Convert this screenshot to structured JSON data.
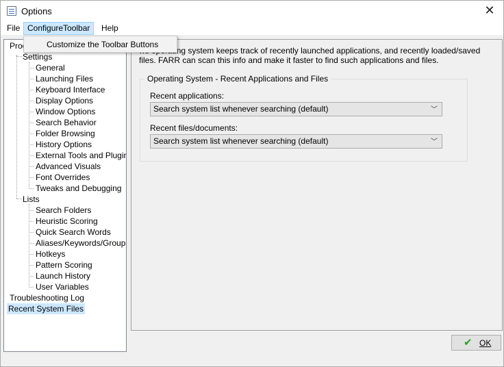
{
  "window": {
    "title": "Options",
    "close_glyph": "✕"
  },
  "menubar": {
    "items": [
      {
        "label": "File"
      },
      {
        "label": "ConfigureToolbar"
      },
      {
        "label": "Help"
      }
    ],
    "active_menu": "ConfigureToolbar",
    "dropdown_items": [
      {
        "label": "Customize the Toolbar Buttons"
      }
    ]
  },
  "tree": {
    "items": [
      {
        "label": "Prog"
      },
      {
        "label": "Settings"
      },
      {
        "label": "General"
      },
      {
        "label": "Launching Files"
      },
      {
        "label": "Keyboard Interface"
      },
      {
        "label": "Display Options"
      },
      {
        "label": "Window Options"
      },
      {
        "label": "Search Behavior"
      },
      {
        "label": "Folder Browsing"
      },
      {
        "label": "History Options"
      },
      {
        "label": "External Tools and Plugins"
      },
      {
        "label": "Advanced Visuals"
      },
      {
        "label": "Font Overrides"
      },
      {
        "label": "Tweaks and Debugging"
      },
      {
        "label": "Lists"
      },
      {
        "label": "Search Folders"
      },
      {
        "label": "Heuristic Scoring"
      },
      {
        "label": "Quick Search Words"
      },
      {
        "label": "Aliases/Keywords/Groups"
      },
      {
        "label": "Hotkeys"
      },
      {
        "label": "Pattern Scoring"
      },
      {
        "label": "Launch History"
      },
      {
        "label": "User Variables"
      },
      {
        "label": "Troubleshooting Log"
      },
      {
        "label": "Recent System Files"
      }
    ],
    "selected": "Recent System Files"
  },
  "content": {
    "description": "ws operating system keeps track of recently launched applications, and recently loaded/saved files.  FARR can scan this info and make it faster to find such applications and files.",
    "group_title": "Operating System - Recent Applications and Files",
    "recent_apps_label": "Recent applications:",
    "recent_apps_value": "Search system list whenever searching (default)",
    "recent_files_label": "Recent files/documents:",
    "recent_files_value": "Search system list whenever searching (default)",
    "chevron": "﹀"
  },
  "footer": {
    "ok_label": "OK",
    "ok_icon": "checkmark-icon",
    "ok_icon_color": "#2a9a2a"
  },
  "colors": {
    "selection": "#cce8ff",
    "selection_border": "#99d1ff",
    "window_bg": "#f0f0f0"
  }
}
